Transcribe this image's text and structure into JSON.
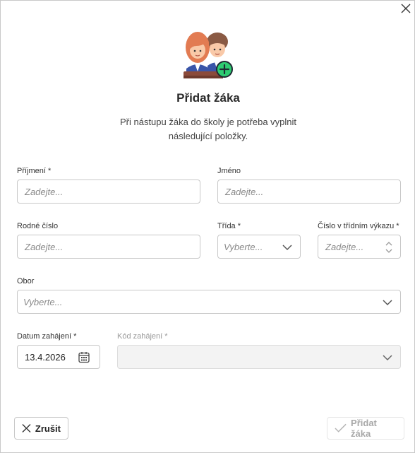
{
  "dialog": {
    "title": "Přidat žáka",
    "subtitle": "Při nástupu žáka do školy je potřeba vyplnit následující položky."
  },
  "fields": {
    "prijmeni": {
      "label": "Příjmení *",
      "placeholder": "Zadejte..."
    },
    "jmeno": {
      "label": "Jméno",
      "placeholder": "Zadejte..."
    },
    "rodne_cislo": {
      "label": "Rodné číslo",
      "placeholder": "Zadejte..."
    },
    "trida": {
      "label": "Třída *",
      "placeholder": "Vyberte..."
    },
    "cislo_vykazu": {
      "label": "Číslo v třídním výkazu *",
      "placeholder": "Zadejte..."
    },
    "obor": {
      "label": "Obor",
      "placeholder": "Vyberte..."
    },
    "datum_zahajeni": {
      "label": "Datum zahájení *",
      "value": "13.4.2026"
    },
    "kod_zahajeni": {
      "label": "Kód zahájení *"
    }
  },
  "buttons": {
    "cancel": "Zrušit",
    "submit": "Přidat žáka"
  },
  "icons": {
    "close": "close-icon",
    "cancel": "x-icon",
    "submit": "check-icon",
    "dropdown": "chevron-down-icon",
    "calendar": "calendar-icon",
    "illustration": "students-add-illustration"
  },
  "colors": {
    "accent_green": "#2ecc71",
    "border": "#c8c8c8",
    "disabled_bg": "#f3f3f3"
  }
}
